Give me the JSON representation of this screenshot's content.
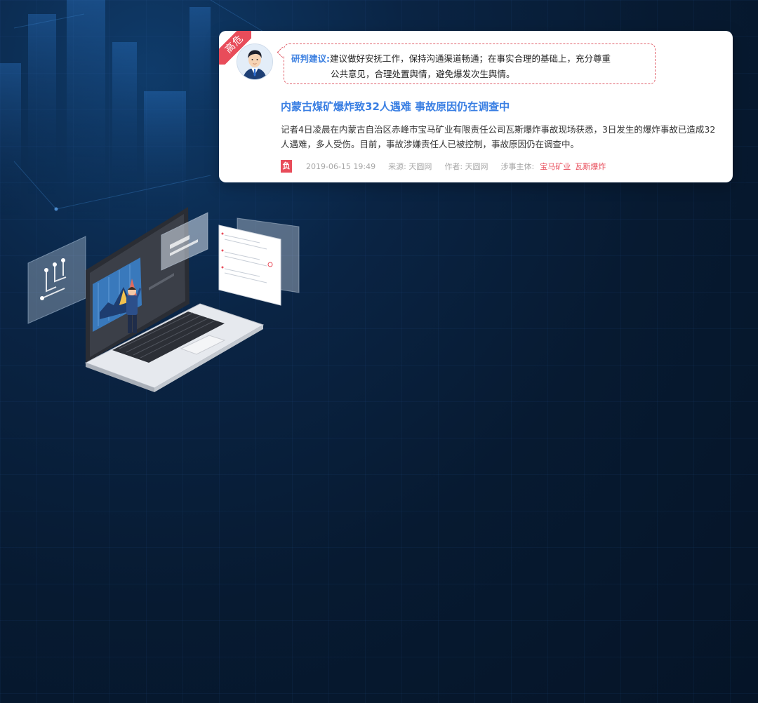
{
  "card": {
    "risk_tag": "高危",
    "advice_label": "研判建议:",
    "advice_text_line1": "建议做好安抚工作，保持沟通渠道畅通；在事实合理的基础上，充分尊重",
    "advice_text_line2": "公共意见，合理处置舆情，避免爆发次生舆情。",
    "title": "内蒙古煤矿爆炸致32人遇难 事故原因仍在调查中",
    "summary": "记者4日凌晨在内蒙古自治区赤峰市宝马矿业有限责任公司瓦斯爆炸事故现场获悉，3日发生的爆炸事故已造成32人遇难，多人受伤。目前，事故涉嫌责任人已被控制，事故原因仍在调查中。",
    "sentiment_badge": "负",
    "datetime": "2019-06-15 19:49",
    "source_label": "来源:",
    "source": "天圆网",
    "author_label": "作者:",
    "author": "天圆网",
    "subject_label": "涉事主体:",
    "subjects": [
      "宝马矿业",
      "瓦斯爆炸"
    ]
  },
  "colors": {
    "accent_blue": "#3a7fe3",
    "risk_red": "#e84c5a",
    "background_navy": "#071a31"
  }
}
